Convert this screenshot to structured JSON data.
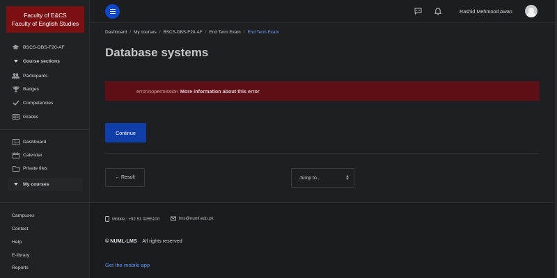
{
  "sidebar": {
    "brand_line1": "Faculty of E&CS",
    "brand_line2": "Faculty of English Studies",
    "course_code": "BSCS-DBS-F20-AF",
    "course_sections": "Course sections",
    "items": [
      {
        "label": "Participants",
        "icon": "users-icon"
      },
      {
        "label": "Badges",
        "icon": "trophy-icon"
      },
      {
        "label": "Competencies",
        "icon": "check-icon"
      },
      {
        "label": "Grades",
        "icon": "table-icon"
      }
    ],
    "nav": [
      {
        "label": "Dashboard",
        "icon": "dashboard-icon"
      },
      {
        "label": "Calendar",
        "icon": "calendar-icon"
      },
      {
        "label": "Private files",
        "icon": "file-icon"
      }
    ],
    "my_courses": "My courses",
    "bottom_links": [
      "Campuses",
      "Contact",
      "Help",
      "E-library",
      "Reports"
    ]
  },
  "topbar": {
    "user_name": "Rashid Mehmood Awan",
    "icons": [
      "menu-icon",
      "message-icon",
      "bell-icon",
      "avatar"
    ]
  },
  "breadcrumb": [
    "Dashboard",
    "My courses",
    "BSCS-DBS-F20-AF",
    "End Term Exam",
    "End Term Exam"
  ],
  "page_title": "Database systems",
  "alert": {
    "code": "error/nopermission",
    "more": "More information about this error"
  },
  "continue_label": "Continue",
  "result_label": "← Result",
  "jump_label": "Jump to...",
  "footer": {
    "mobile": "Mobile : +92 51 9265100",
    "email": "lms@numl.edu.pk",
    "brand": "© NUML-LMS",
    "rights": "All rights reserved",
    "mobile_app": "Get the mobile app"
  },
  "colors": {
    "brand_red": "#7b0f12",
    "primary_blue": "#0f3ea8",
    "alert_bg": "#5c0f17",
    "link_blue": "#6e9ef0"
  }
}
